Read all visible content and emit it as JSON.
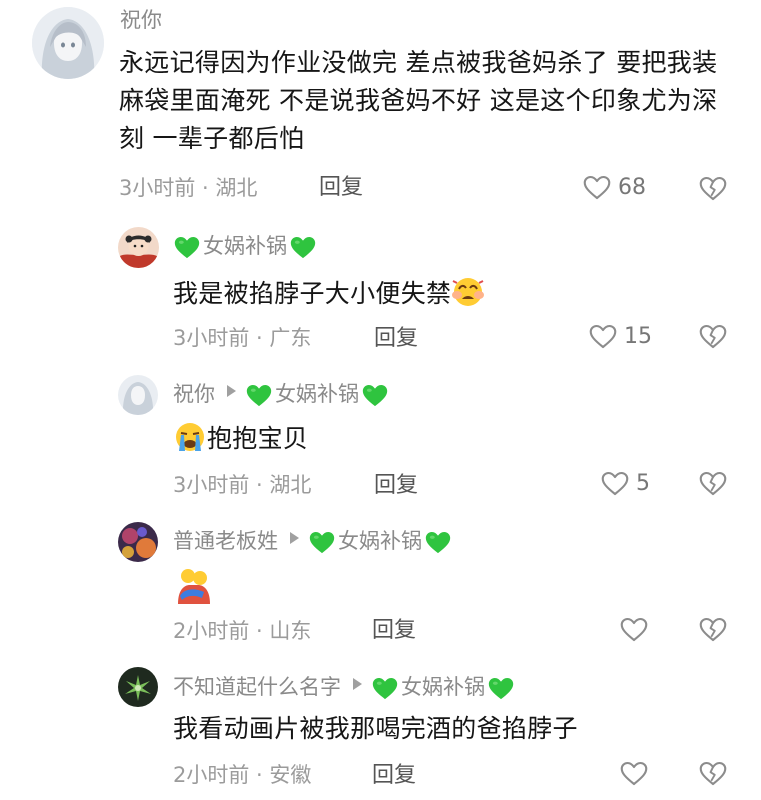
{
  "comments": [
    {
      "author": "祝你",
      "text": "永远记得因为作业没做完 差点被我爸妈杀了 要把我装麻袋里面淹死 不是说我爸妈不好 这是这个印象尤为深刻 一辈子都后怕",
      "time_location": "3小时前 · 湖北",
      "reply_label": "回复",
      "likes": "68"
    }
  ],
  "replies": [
    {
      "author": "女娲补锅",
      "author_hearts": true,
      "text": "我是被掐脖子大小便失禁",
      "emoji": "crying-face",
      "time_location": "3小时前 · 广东",
      "reply_label": "回复",
      "likes": "15"
    },
    {
      "author": "祝你",
      "reply_to": "女娲补锅",
      "text": "抱抱宝贝",
      "emoji": "loudly-crying-face",
      "time_location": "3小时前 · 湖北",
      "reply_label": "回复",
      "likes": "5"
    },
    {
      "author": "普通老板姓",
      "reply_to": "女娲补锅",
      "text": "",
      "emoji": "hugging-people",
      "time_location": "2小时前 · 山东",
      "reply_label": "回复",
      "likes": ""
    },
    {
      "author": "不知道起什么名字",
      "reply_to": "女娲补锅",
      "text": "我看动画片被我那喝完酒的爸掐脖子",
      "time_location": "2小时前 · 安徽",
      "reply_label": "回复",
      "likes": ""
    }
  ],
  "colors": {
    "green_heart": "#2fc43f",
    "text": "#161616",
    "meta": "#9b9b9b"
  },
  "icons": [
    "heart-outline-icon",
    "broken-heart-icon",
    "green-heart-icon",
    "reply-arrow-icon"
  ]
}
